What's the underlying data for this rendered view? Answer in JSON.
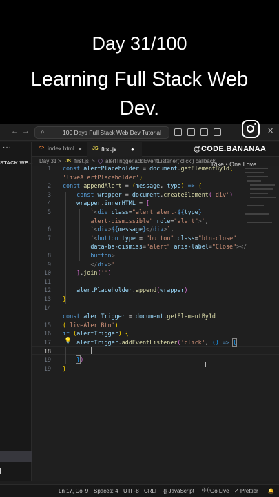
{
  "caption": {
    "line1": "Day 31/100",
    "line2a": "Learning Full Stack Web",
    "line2b": "Dev."
  },
  "titlebar": {
    "search": "100 Days Full Stack Web Dev Tutorial"
  },
  "sidebar": {
    "title": "STACK WE..."
  },
  "tabs": [
    {
      "icon": "<>",
      "label": "index.html",
      "modified": true
    },
    {
      "icon": "JS",
      "label": "first.js",
      "modified": true
    }
  ],
  "overlay": {
    "handle": "@CODE.BANANAA",
    "music": "Rike • One Love"
  },
  "breadcrumb": [
    "Day 31",
    ">",
    "JS",
    "first.js",
    ">",
    "alertTrigger.addEventListener('click') callback"
  ],
  "code_lines": [
    "1",
    "",
    "2",
    "3",
    "4",
    "5",
    "",
    "6",
    "7",
    "",
    "8",
    "9",
    "10",
    "11",
    "12",
    "13",
    "14",
    "",
    "15",
    "16",
    "17",
    "18",
    "19"
  ],
  "statusbar": {
    "position": "Ln 17, Col 9",
    "spaces": "Spaces: 4",
    "encoding": "UTF-8",
    "eol": "CRLF",
    "language": "{} JavaScript",
    "golive": "Go Live",
    "prettier": "✓ Prettier",
    "bell": "🔔"
  },
  "colors": {
    "accent": "#0078d4",
    "editor_bg": "#1f1f1f",
    "keyword": "#569cd6",
    "string": "#ce9178",
    "function": "#dcdcaa",
    "variable": "#9cdcfe"
  }
}
